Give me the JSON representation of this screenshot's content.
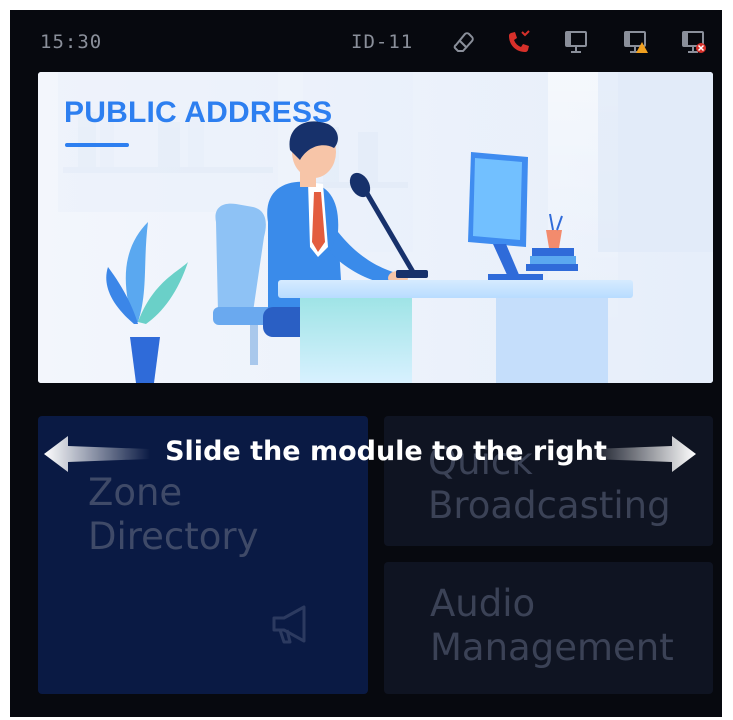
{
  "status_bar": {
    "time": "15:30",
    "device_id": "ID-11",
    "icons": [
      "eraser-icon",
      "phone-missed-icon",
      "monitor-icon",
      "monitor-warning-icon",
      "monitor-error-icon"
    ]
  },
  "banner": {
    "title": "PUBLIC ADDRESS"
  },
  "modules": {
    "zone_directory": {
      "line1": "Zone",
      "line2": "Directory",
      "icon": "megaphone-icon"
    },
    "quick_broadcasting": {
      "line1": "Quick",
      "line2": "Broadcasting"
    },
    "audio_management": {
      "line1": "Audio",
      "line2": "Management"
    }
  },
  "overlay": {
    "hint": "Slide the module to the right"
  },
  "colors": {
    "background": "#07090f",
    "accent": "#2d7ff0",
    "zone_module": "#0a1a44",
    "module": "#0f1422",
    "missed_call": "#d7302a",
    "warning": "#f0a020",
    "error": "#d7302a"
  }
}
